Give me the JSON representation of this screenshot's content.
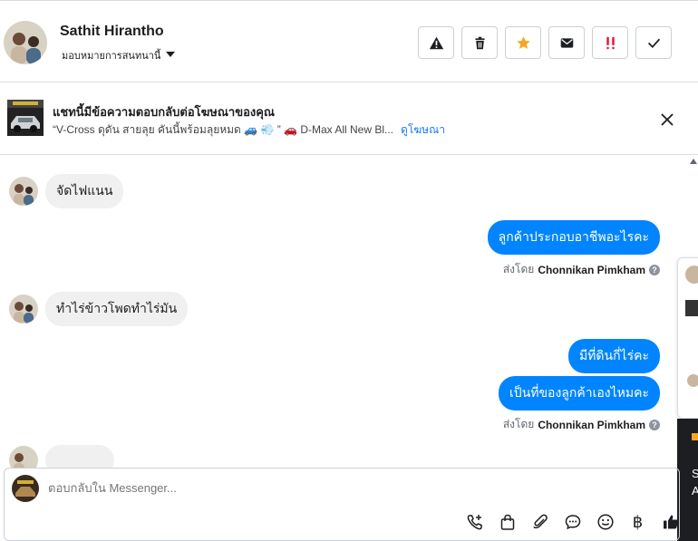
{
  "header": {
    "name": "Sathit Hirantho",
    "assign_label": "มอบหมายการสนทนานี้",
    "actions": [
      {
        "icon": "warning-icon"
      },
      {
        "icon": "trash-icon"
      },
      {
        "icon": "star-icon",
        "color": "#f5a623"
      },
      {
        "icon": "envelope-icon"
      },
      {
        "icon": "double-exclamation-icon",
        "color": "#e41e3f"
      },
      {
        "icon": "checkmark-icon"
      }
    ]
  },
  "ad_banner": {
    "title": "แชทนี้มีข้อความตอบกลับต่อโฆษณาของคุณ",
    "snippet": "“V-Cross ดุดัน สายลุย คันนี้พร้อมลุยหมด 🚙 💨 ” 🚗 D-Max All New Bl...",
    "link": "ดูโฆษณา"
  },
  "messages": [
    {
      "direction": "in",
      "text": "จัดไฟแนน"
    },
    {
      "direction": "out",
      "text": "ลูกค้าประกอบอาชีพอะไรคะ"
    },
    {
      "direction": "meta",
      "prefix": "ส่งโดย",
      "sender": "Chonnikan Pimkham"
    },
    {
      "direction": "in",
      "text": "ทำไร่ข้าวโพดทำไร่มัน"
    },
    {
      "direction": "out",
      "text": "มีที่ดินกี่ไร่คะ"
    },
    {
      "direction": "out",
      "text": "เป็นที่ของลูกค้าเองไหมคะ"
    },
    {
      "direction": "meta",
      "prefix": "ส่งโดย",
      "sender": "Chonnikan Pimkham"
    }
  ],
  "side_panel": {
    "dark_text_1": "S",
    "dark_text_2": "A"
  },
  "composer": {
    "placeholder": "ตอบกลับใน Messenger...",
    "tools": [
      "phone-add-icon",
      "shopping-bag-icon",
      "paperclip-icon",
      "chat-bubble-icon",
      "smiley-icon",
      "baht-icon",
      "thumbs-up-icon"
    ],
    "baht_symbol": "฿"
  },
  "colors": {
    "accent": "#0084ff",
    "link": "#1877f2",
    "star": "#f5a623",
    "alert": "#e41e3f"
  }
}
